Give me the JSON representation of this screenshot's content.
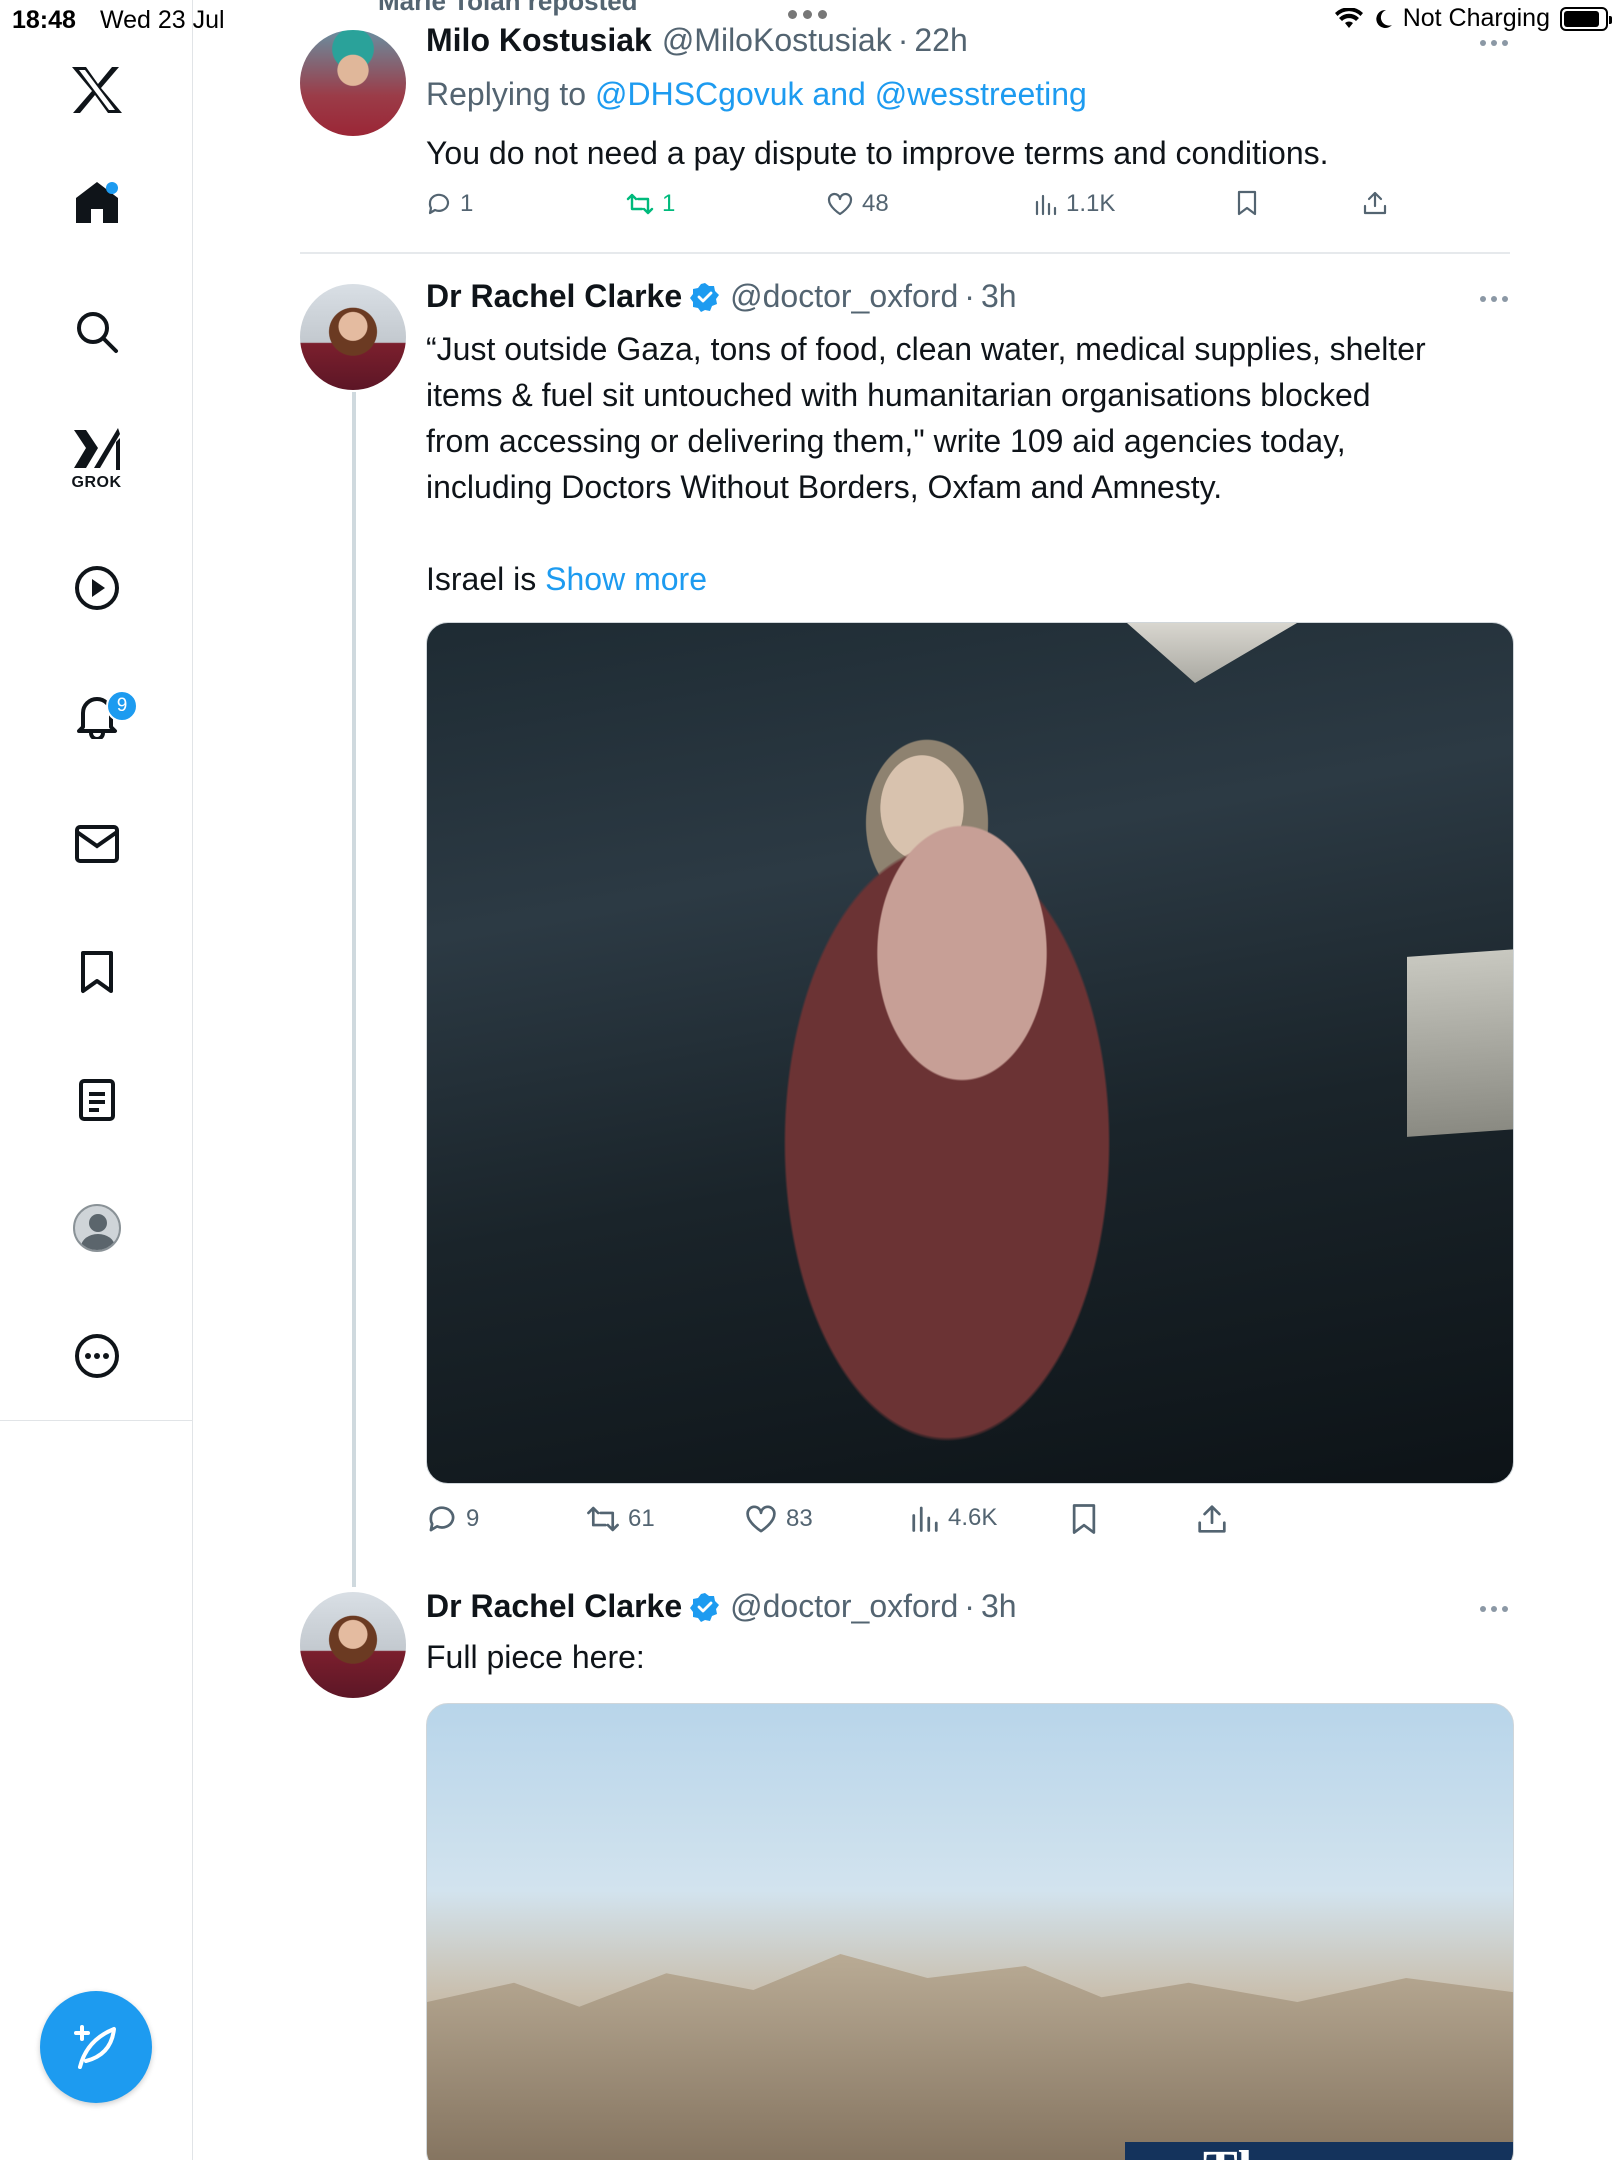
{
  "status_bar": {
    "time": "18:48",
    "date": "Wed 23 Jul",
    "charging": "Not Charging"
  },
  "sidebar": {
    "grok_label": "GROK",
    "notifications_badge": "9",
    "items": [
      "x-logo",
      "home",
      "search",
      "grok",
      "video",
      "notifications",
      "messages",
      "bookmarks",
      "lists",
      "profile",
      "more"
    ]
  },
  "timeline": {
    "reposted_by": "Marie Tolan reposted",
    "tweets": [
      {
        "name": "Milo Kostusiak",
        "handle": "@MiloKostusiak",
        "time": "22h",
        "replying_prefix": "Replying to",
        "replying_to": "@DHSCgovuk and @wesstreeting",
        "text": "You do not need a pay dispute to improve terms and conditions.",
        "replies": "1",
        "reposts": "1",
        "likes": "48",
        "views": "1.1K"
      },
      {
        "name": "Dr Rachel Clarke",
        "handle": "@doctor_oxford",
        "time": "3h",
        "text_lines": [
          "“Just outside Gaza, tons of food, clean water, medical supplies, shelter",
          "items & fuel sit untouched with humanitarian organisations blocked",
          "from accessing or delivering them,\" write 109 aid agencies today,",
          "including Doctors Without Borders, Oxfam and Amnesty."
        ],
        "text_tail": "Israel is ",
        "show_more": "Show more",
        "replies": "9",
        "reposts": "61",
        "likes": "83",
        "views": "4.6K"
      },
      {
        "name": "Dr Rachel Clarke",
        "handle": "@doctor_oxford",
        "time": "3h",
        "text": "Full piece here:",
        "media_caption": "The"
      }
    ]
  },
  "colors": {
    "accent": "#1d9bf0",
    "text": "#0f1419",
    "muted": "#536471",
    "repost_active": "#00ba7c"
  }
}
